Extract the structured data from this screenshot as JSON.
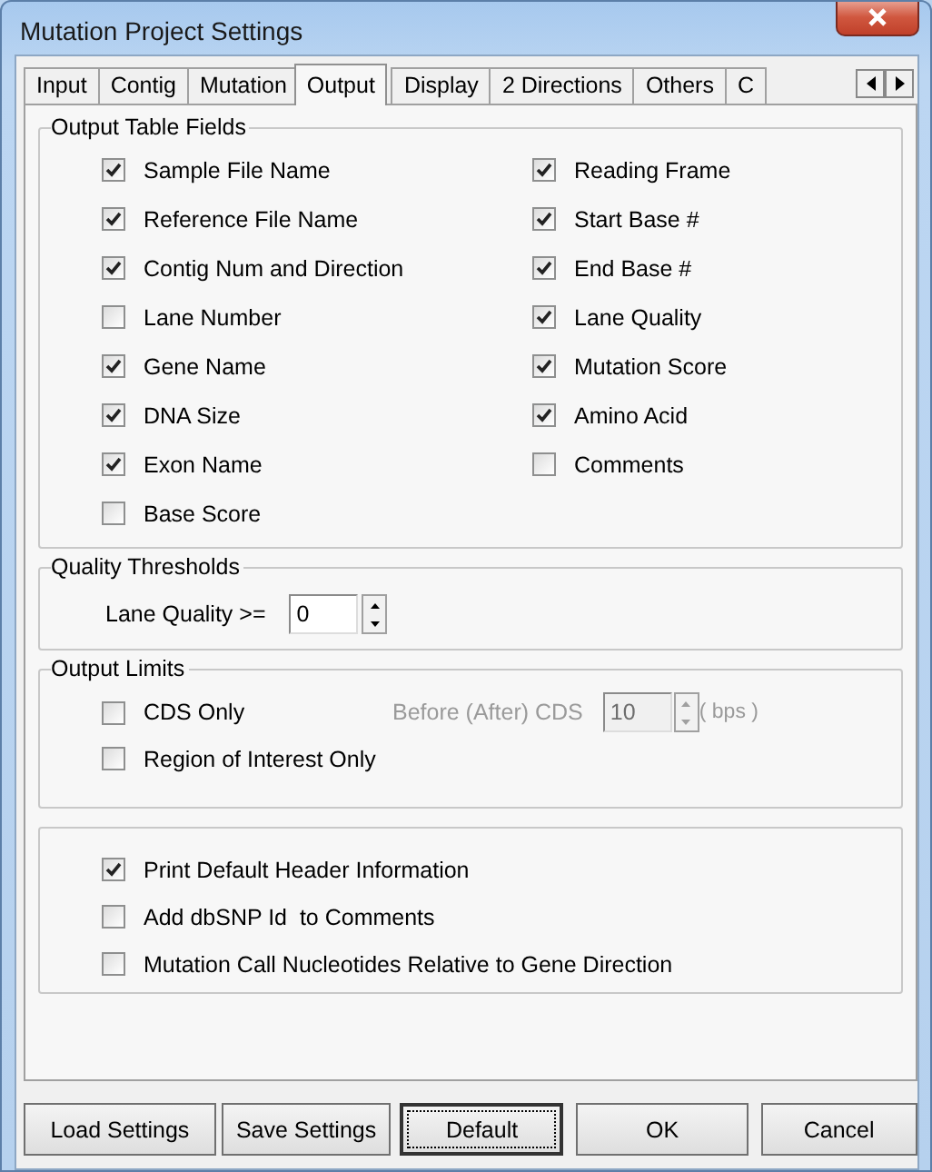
{
  "window": {
    "title": "Mutation Project Settings"
  },
  "tabs": [
    {
      "label": "Input",
      "selected": false
    },
    {
      "label": "Contig",
      "selected": false
    },
    {
      "label": "Mutation",
      "selected": false
    },
    {
      "label": "Output",
      "selected": true
    },
    {
      "label": "Display",
      "selected": false
    },
    {
      "label": "2 Directions",
      "selected": false
    },
    {
      "label": "Others",
      "selected": false
    },
    {
      "label": "C",
      "selected": false
    }
  ],
  "output_table_fields": {
    "title": "Output Table Fields",
    "columns": [
      [
        {
          "label": "Sample File Name",
          "checked": true
        },
        {
          "label": "Reference File Name",
          "checked": true
        },
        {
          "label": "Contig Num and Direction",
          "checked": true
        },
        {
          "label": "Lane Number",
          "checked": false
        },
        {
          "label": "Gene Name",
          "checked": true
        },
        {
          "label": "DNA Size",
          "checked": true
        },
        {
          "label": "Exon Name",
          "checked": true
        },
        {
          "label": "Base Score",
          "checked": false
        }
      ],
      [
        {
          "label": "Reading Frame",
          "checked": true
        },
        {
          "label": "Start Base #",
          "checked": true
        },
        {
          "label": "End Base #",
          "checked": true
        },
        {
          "label": "Lane Quality",
          "checked": true
        },
        {
          "label": "Mutation Score",
          "checked": true
        },
        {
          "label": "Amino Acid",
          "checked": true
        },
        {
          "label": "Comments",
          "checked": false
        }
      ]
    ]
  },
  "quality_thresholds": {
    "title": "Quality Thresholds",
    "label": "Lane Quality >=",
    "value": "0"
  },
  "output_limits": {
    "title": "Output Limits",
    "options": [
      {
        "label": "CDS Only",
        "checked": false
      },
      {
        "label": "Region of Interest Only",
        "checked": false
      }
    ],
    "offset": {
      "label": "Before (After) CDS",
      "value": "10",
      "unit": "( bps )",
      "disabled": true
    }
  },
  "header_options": [
    {
      "label": "Print Default Header Information",
      "checked": true
    },
    {
      "label": "Add dbSNP Id  to Comments",
      "checked": false
    },
    {
      "label": "Mutation Call Nucleotides Relative to Gene Direction",
      "checked": false
    }
  ],
  "buttons": [
    {
      "label": "Load Settings",
      "focused": false
    },
    {
      "label": "Save Settings",
      "focused": false
    },
    {
      "label": "Default",
      "focused": true
    },
    {
      "label": "OK",
      "focused": false
    },
    {
      "label": "Cancel",
      "focused": false
    }
  ]
}
